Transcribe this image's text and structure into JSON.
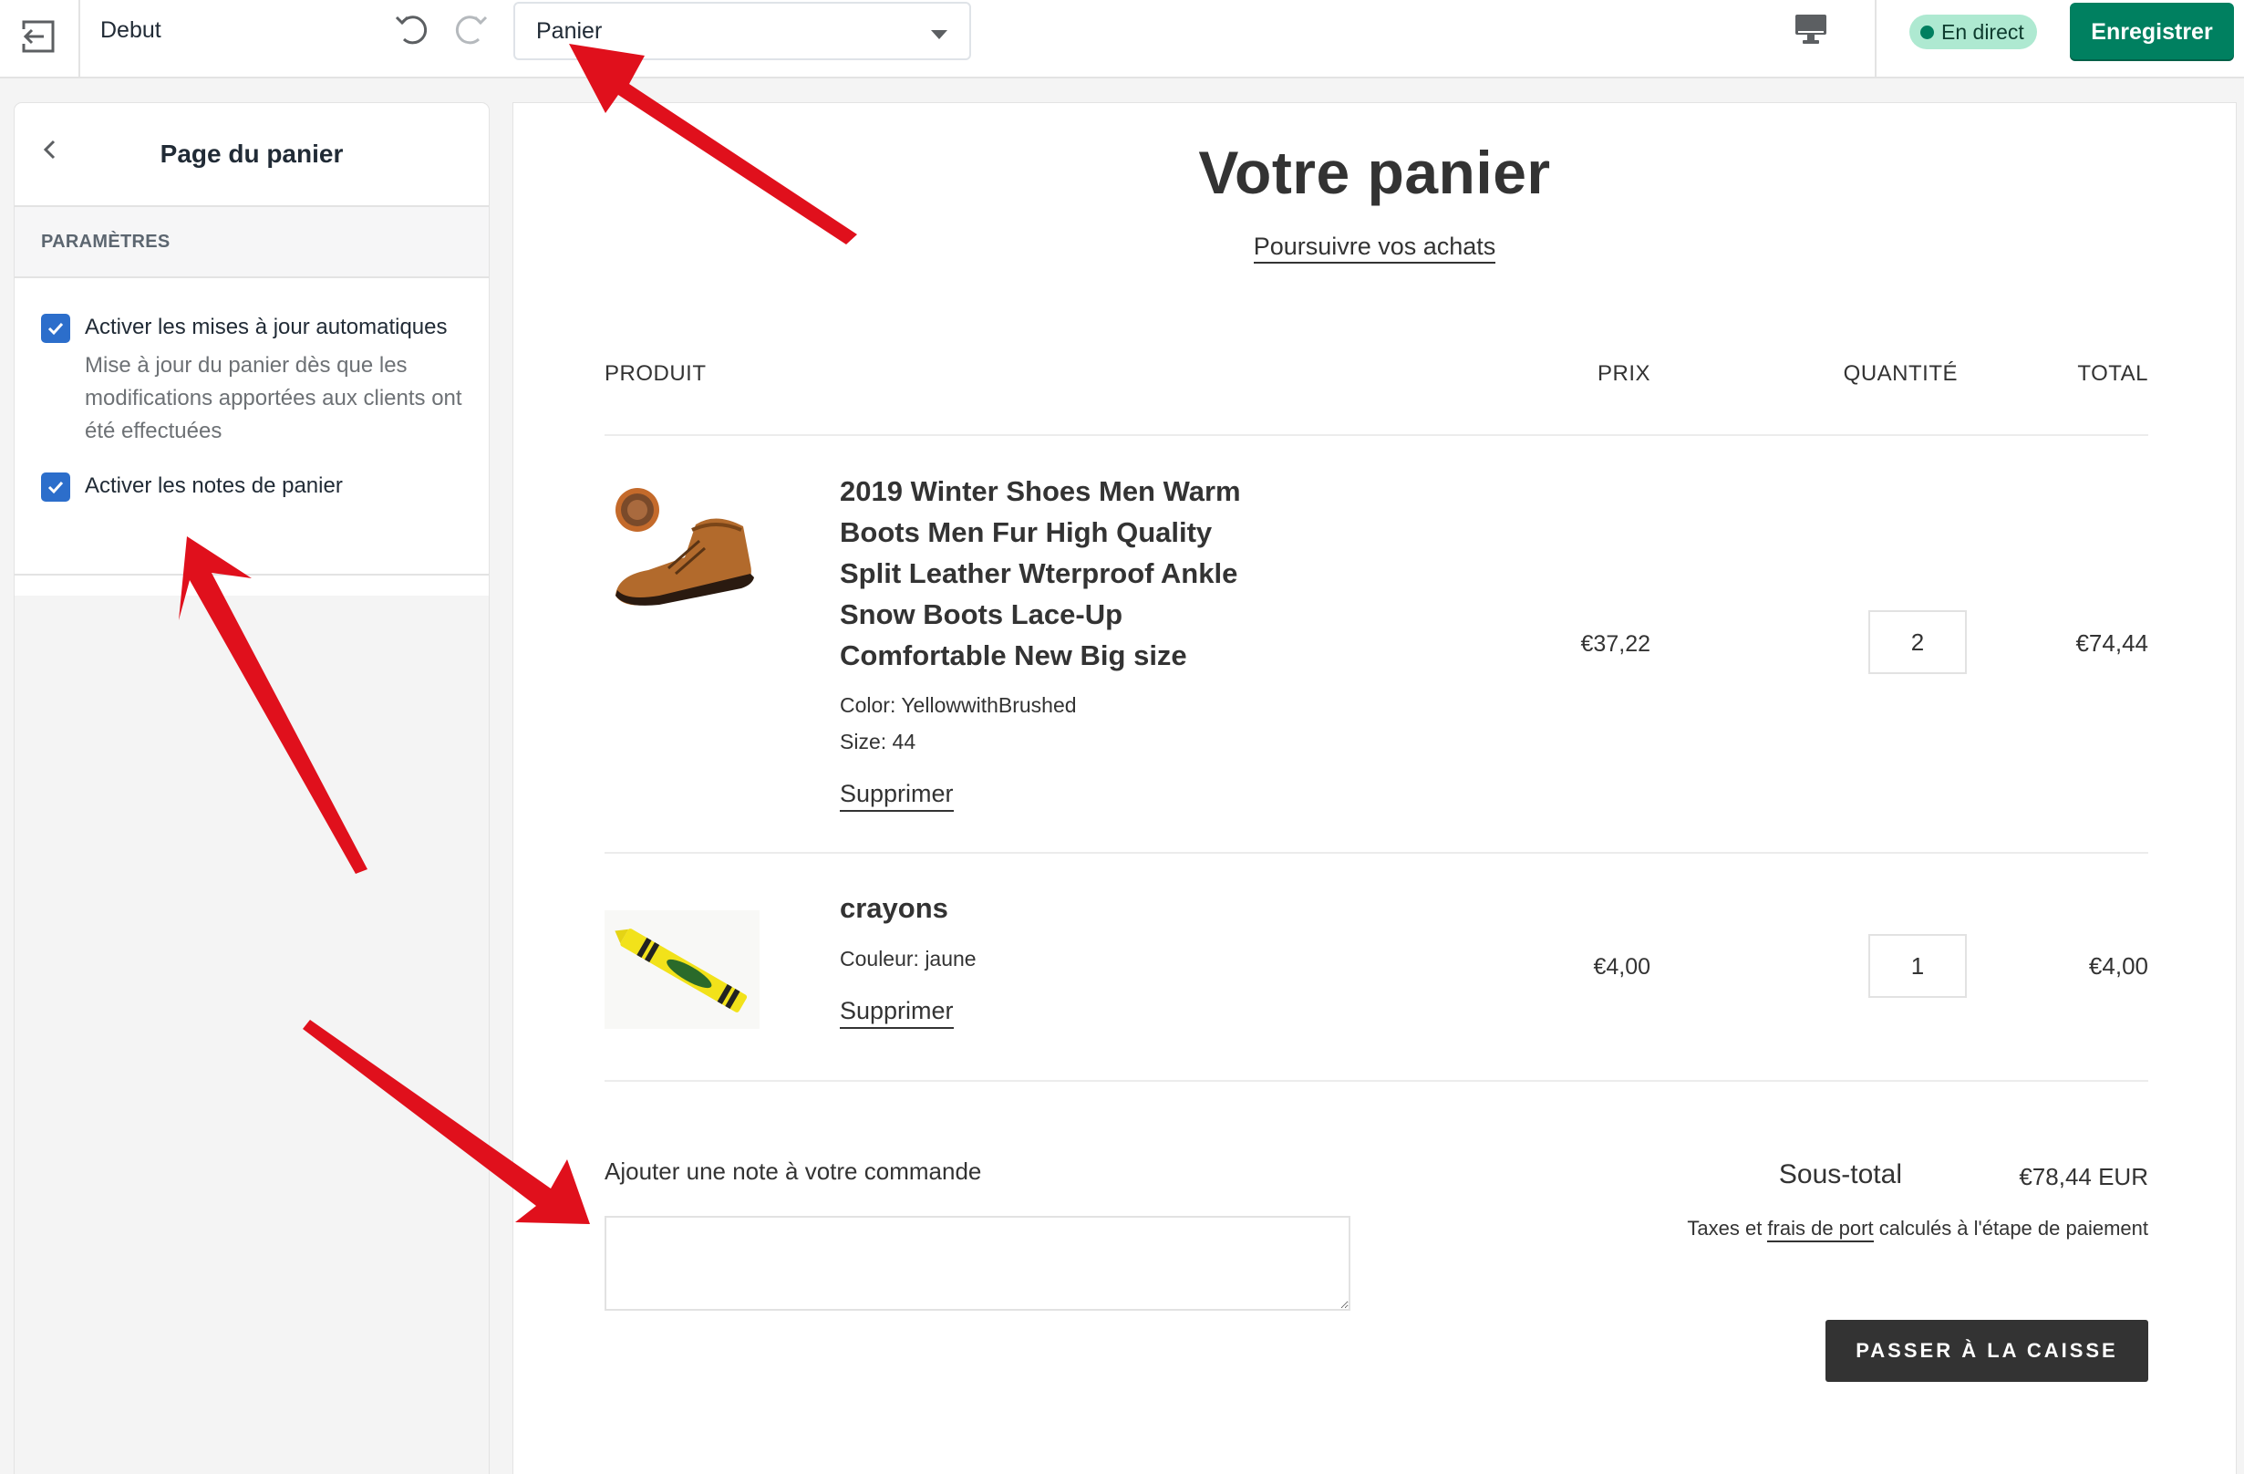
{
  "topbar": {
    "theme_name": "Debut",
    "page_select": {
      "selected": "Panier"
    },
    "live_status": "En direct",
    "save_label": "Enregistrer"
  },
  "sidebar": {
    "title": "Page du panier",
    "section_label": "PARAMÈTRES",
    "settings": [
      {
        "label": "Activer les mises à jour automatiques",
        "help": "Mise à jour du panier dès que les modifications apportées aux clients ont été effectuées",
        "checked": true
      },
      {
        "label": "Activer les notes de panier",
        "checked": true
      }
    ]
  },
  "cart": {
    "title": "Votre panier",
    "continue_label": "Poursuivre vos achats",
    "columns": {
      "product": "PRODUIT",
      "price": "PRIX",
      "quantity": "QUANTITÉ",
      "total": "TOTAL"
    },
    "items": [
      {
        "name": "2019 Winter Shoes Men Warm Boots Men Fur High Quality Split Leather Wterproof Ankle Snow Boots Lace-Up Comfortable New Big size",
        "variants": [
          "Color: YellowwithBrushed",
          "Size: 44"
        ],
        "remove_label": "Supprimer",
        "price": "€37,22",
        "quantity": "2",
        "total": "€74,44"
      },
      {
        "name": "crayons",
        "variants": [
          "Couleur: jaune"
        ],
        "remove_label": "Supprimer",
        "price": "€4,00",
        "quantity": "1",
        "total": "€4,00"
      }
    ],
    "note_label": "Ajouter une note à votre commande",
    "subtotal_label": "Sous-total",
    "subtotal_value": "€78,44 EUR",
    "taxes_prefix": "Taxes et ",
    "taxes_link": "frais de port",
    "taxes_suffix": " calculés à l'étape de paiement",
    "checkout_label": "PASSER À LA CAISSE"
  },
  "colors": {
    "save_button": "#008060",
    "live_badge_bg": "#aee9d1",
    "checkbox": "#2c6ecb",
    "checkout_button": "#333333",
    "annotation_arrow": "#e0101c"
  }
}
